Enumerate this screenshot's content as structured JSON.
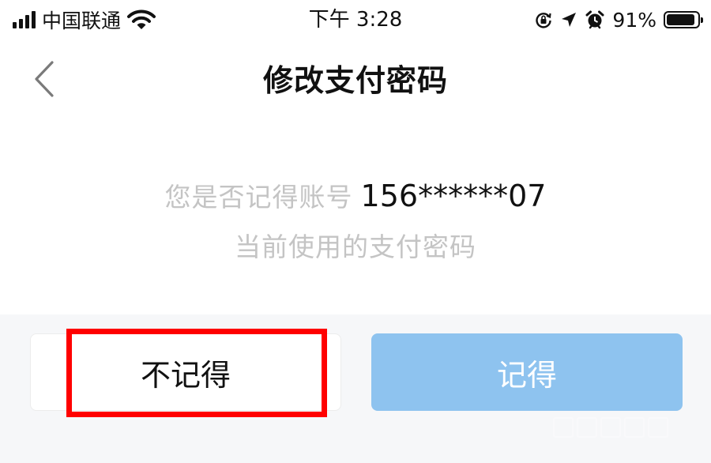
{
  "status_bar": {
    "carrier": "中国联通",
    "time": "下午 3:28",
    "battery_percent": "91%",
    "battery_level": 0.91
  },
  "nav": {
    "title": "修改支付密码"
  },
  "prompt": {
    "question": "您是否记得账号",
    "account": "156******07",
    "line2": "当前使用的支付密码"
  },
  "actions": {
    "forget_label": "不记得",
    "remember_label": "记得"
  },
  "colors": {
    "remember_button_bg": "#8ec3ef",
    "highlight": "#ff0000",
    "muted_text": "#c4c4c4",
    "action_area_bg": "#f6f7f9"
  }
}
